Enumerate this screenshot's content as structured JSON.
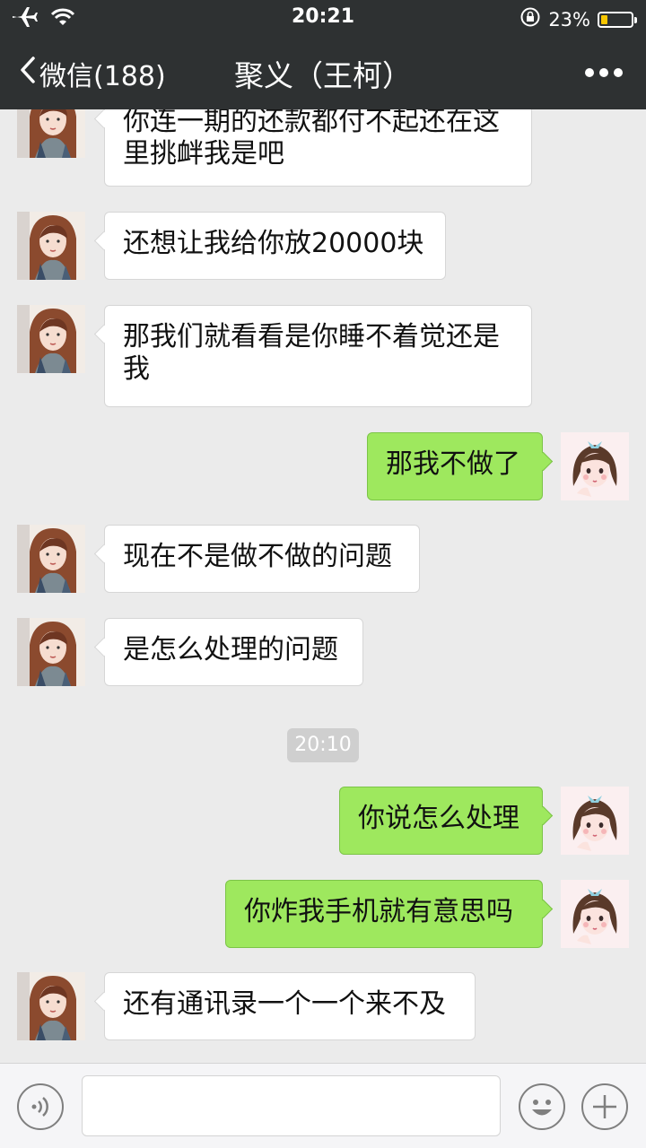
{
  "status_bar": {
    "time": "20:21",
    "battery": "23%",
    "battery_level": 0.23
  },
  "nav": {
    "back_label": "微信(188)",
    "title": "聚义（王柯）"
  },
  "messages": [
    {
      "side": "left",
      "text": "你连一期的还款都付不起还在这里挑衅我是吧"
    },
    {
      "side": "left",
      "text": "还想让我给你放20000块"
    },
    {
      "side": "left",
      "text": "那我们就看看是你睡不着觉还是我"
    },
    {
      "side": "right",
      "text": "那我不做了"
    },
    {
      "side": "left",
      "text": "现在不是做不做的问题"
    },
    {
      "side": "left",
      "text": "是怎么处理的问题"
    },
    {
      "side": "right",
      "text": "你说怎么处理"
    },
    {
      "side": "right",
      "text": "你炸我手机就有意思吗"
    },
    {
      "side": "left",
      "text": "还有通讯录一个一个来不及"
    }
  ],
  "timestamp": "20:10",
  "input": {
    "placeholder": "",
    "value": ""
  },
  "icons": {
    "back": "chevron-left-icon",
    "more": "more-dots-icon",
    "voice": "voice-icon",
    "emoji": "emoji-icon",
    "plus": "plus-icon",
    "airplane": "airplane-icon",
    "wifi": "wifi-icon",
    "lock": "orientation-lock-icon"
  },
  "colors": {
    "nav_bg": "#2e3132",
    "sent_bubble": "#9ee85e",
    "received_bubble": "#ffffff",
    "chat_bg": "#ebebeb"
  }
}
